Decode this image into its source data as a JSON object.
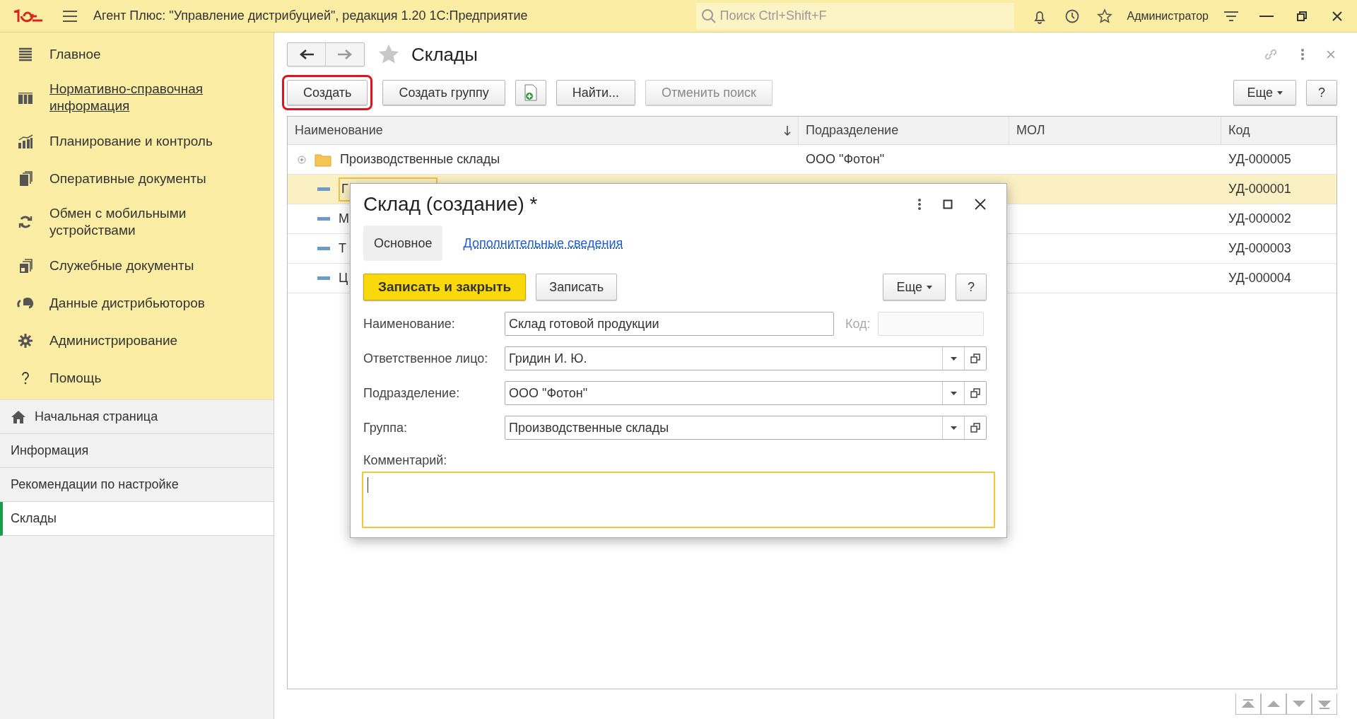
{
  "title_bar": {
    "app_title": "Агент Плюс: \"Управление дистрибуцией\", редакция 1.20 1С:Предприятие",
    "search": {
      "placeholder": "Поиск Ctrl+Shift+F"
    },
    "user": "Администратор"
  },
  "sidebar": {
    "sections": [
      {
        "label": "Главное",
        "hovered": false
      },
      {
        "label": "Нормативно-справочная информация",
        "hovered": true
      },
      {
        "label": "Планирование и контроль",
        "hovered": false
      },
      {
        "label": "Оперативные документы",
        "hovered": false
      },
      {
        "label": "Обмен с мобильными устройствами",
        "hovered": false
      },
      {
        "label": "Служебные документы",
        "hovered": false
      },
      {
        "label": "Данные дистрибьюторов",
        "hovered": false
      },
      {
        "label": "Администрирование",
        "hovered": false
      },
      {
        "label": "Помощь",
        "hovered": false
      }
    ],
    "open_windows": [
      {
        "label": "Начальная страница",
        "kind": "home",
        "selected": false
      },
      {
        "label": "Информация",
        "kind": "plain",
        "selected": false
      },
      {
        "label": "Рекомендации по настройке",
        "kind": "plain",
        "selected": false
      },
      {
        "label": "Склады",
        "kind": "plain",
        "selected": true
      }
    ]
  },
  "form": {
    "title": "Склады",
    "toolbar": [
      {
        "label": "Создать",
        "kind": "button",
        "disabled": false,
        "highlighted": true
      },
      {
        "label": "Создать группу",
        "kind": "button",
        "disabled": false,
        "highlighted": false
      },
      {
        "kind": "icon",
        "disabled": false,
        "highlighted": false
      },
      {
        "label": "Найти...",
        "kind": "button",
        "disabled": false,
        "highlighted": false
      },
      {
        "label": "Отменить поиск",
        "kind": "button",
        "disabled": true,
        "highlighted": false
      }
    ],
    "more_button": "Еще",
    "help_button": "?",
    "table": {
      "columns": [
        "Наименование",
        "Подразделение",
        "МОЛ",
        "Код"
      ],
      "rows": [
        {
          "kind": "group",
          "name": "Производственные склады",
          "department": "ООО \"Фотон\"",
          "code": "УД-000005",
          "selected": false
        },
        {
          "kind": "item",
          "name": "Г",
          "code": "УД-000001",
          "selected": true
        },
        {
          "kind": "item",
          "name": "М",
          "code": "УД-000002",
          "selected": false
        },
        {
          "kind": "item",
          "name": "Т",
          "code": "УД-000003",
          "selected": false
        },
        {
          "kind": "item",
          "name": "Ц",
          "code": "УД-000004",
          "selected": false
        }
      ]
    }
  },
  "dialog": {
    "title": "Склад (создание) *",
    "tabs": [
      {
        "label": "Основное",
        "selected": true
      },
      {
        "label": "Дополнительные сведения",
        "selected": false
      }
    ],
    "buttons": [
      {
        "label": "Записать и закрыть",
        "kind": "primary"
      },
      {
        "label": "Записать",
        "kind": "default"
      }
    ],
    "more_button": "Еще",
    "help_button": "?",
    "name_field": {
      "label": "Наименование:",
      "value": "Склад готовой продукции"
    },
    "code_field": {
      "label": "Код:",
      "disabled": true
    },
    "fields": [
      {
        "label": "Ответственное лицо:",
        "value": "Гридин И. Ю."
      },
      {
        "label": "Подразделение:",
        "value": "ООО \"Фотон\""
      },
      {
        "label": "Группа:",
        "value": "Производственные склады"
      }
    ],
    "comment": {
      "label": "Комментарий:",
      "focused": true
    }
  }
}
